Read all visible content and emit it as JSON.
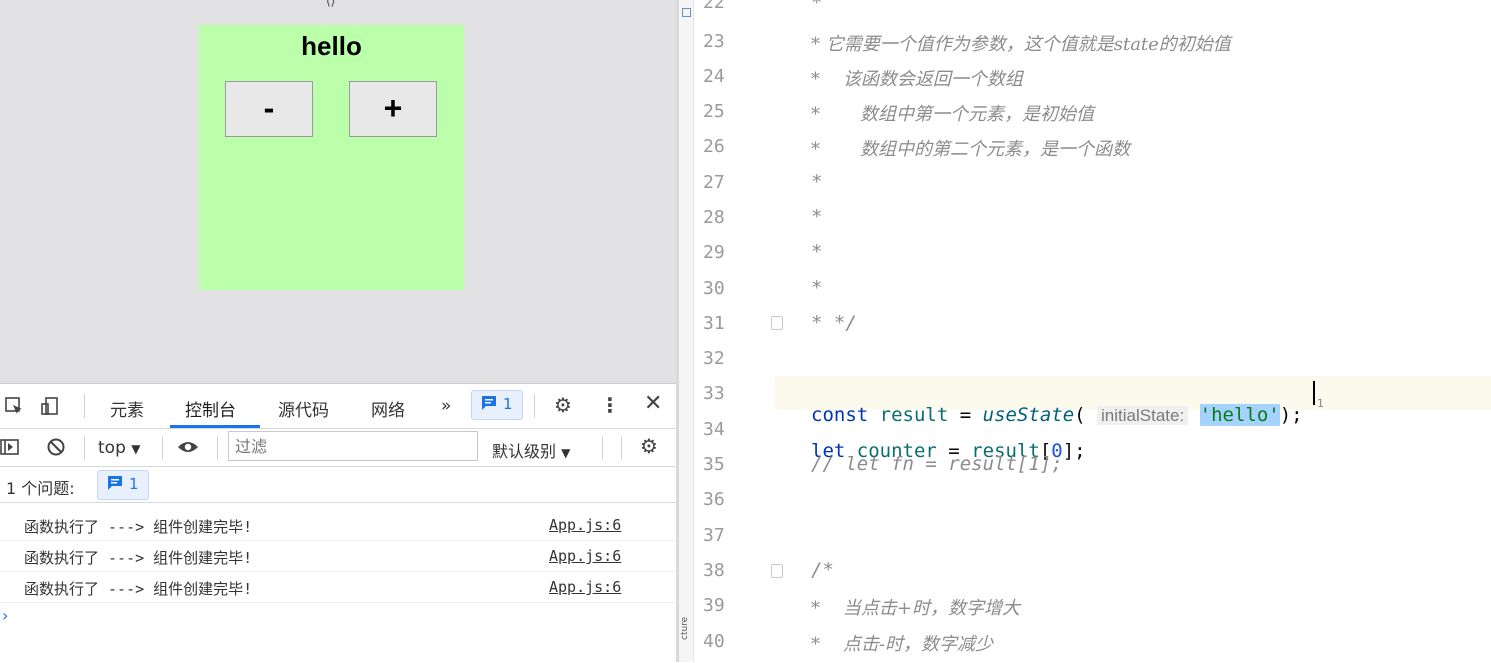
{
  "preview": {
    "title": "hello",
    "minus_label": "-",
    "plus_label": "+"
  },
  "devtools": {
    "tabs": [
      "元素",
      "控制台",
      "源代码",
      "网络"
    ],
    "more_tabs": "»",
    "message_badge_count": "1",
    "context": "top",
    "filter_placeholder": "过滤",
    "level": "默认级别",
    "issues_label": "1 个问题:",
    "issues_count": "1",
    "logs": [
      {
        "message": "函数执行了 ---> 组件创建完毕!",
        "source": "App.js:6"
      },
      {
        "message": "函数执行了 ---> 组件创建完毕!",
        "source": "App.js:6"
      },
      {
        "message": "函数执行了 ---> 组件创建完毕!",
        "source": "App.js:6"
      }
    ],
    "prompt": "›",
    "accent_color": "#1a73e8"
  },
  "editor": {
    "structure_label": "cture",
    "line_numbers": [
      "22",
      "23",
      "24",
      "25",
      "26",
      "27",
      "28",
      "29",
      "30",
      "31",
      "32",
      "33",
      "34",
      "35",
      "36",
      "37",
      "38",
      "39",
      "40"
    ],
    "lines": {
      "l22": "*",
      "l23": "* 它需要一个值作为参数，这个值就是state的初始值",
      "l24": "*    该函数会返回一个数组",
      "l25": "*       数组中第一个元素，是初始值",
      "l26": "*       数组中的第二个元素，是一个函数",
      "l27": "*",
      "l28": "*",
      "l29": "*",
      "l30": "*",
      "l31": "* */",
      "l33_const": "const",
      "l33_var": "result",
      "l33_eq": " = ",
      "l33_fn": "useState",
      "l33_open": "( ",
      "l33_hint": "initialState:",
      "l33_arg": "'hello'",
      "l33_close": ");",
      "l34_let": "let",
      "l34_var": "counter",
      "l34_eq": " = ",
      "l34_ref": "result",
      "l34_open": "[",
      "l34_idx": "0",
      "l34_close": "];",
      "l35": "// let fn = result[1];",
      "l38": "/*",
      "l39": "*    当点击+时，数字增大",
      "l40": "*    点击-时，数字减少"
    },
    "caret_marker": "1"
  }
}
